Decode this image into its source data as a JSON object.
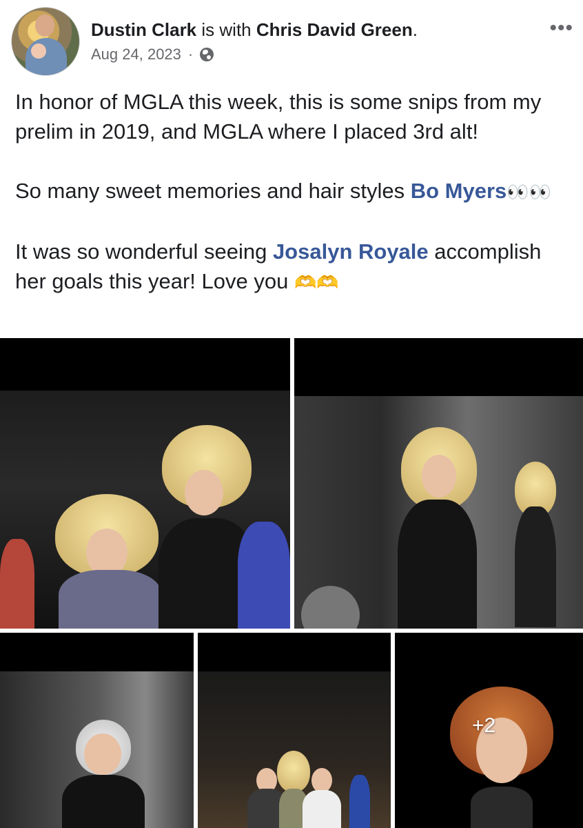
{
  "post": {
    "author": "Dustin Clark",
    "with_text": "is with",
    "tagged_person": "Chris David Green",
    "period": ".",
    "date": "Aug 24, 2023",
    "separator": "·",
    "privacy_icon": "globe-icon",
    "more_icon": "more-options-icon",
    "more_glyph": "•••",
    "text": {
      "line1": "In honor of MGLA this week, this is some snips from my prelim in 2019, and MGLA where I placed 3rd alt!",
      "p2_before": "So many sweet memories and hair styles ",
      "p2_tag": "Bo Myers",
      "p2_emoji": "👀👀",
      "p3_before": "It was so wonderful seeing ",
      "p3_tag": "Josalyn Royale",
      "p3_after": " accomplish her goals this year! Love you ",
      "p3_emoji": "🫶🫶"
    }
  },
  "photos": {
    "more_count": "+2"
  }
}
